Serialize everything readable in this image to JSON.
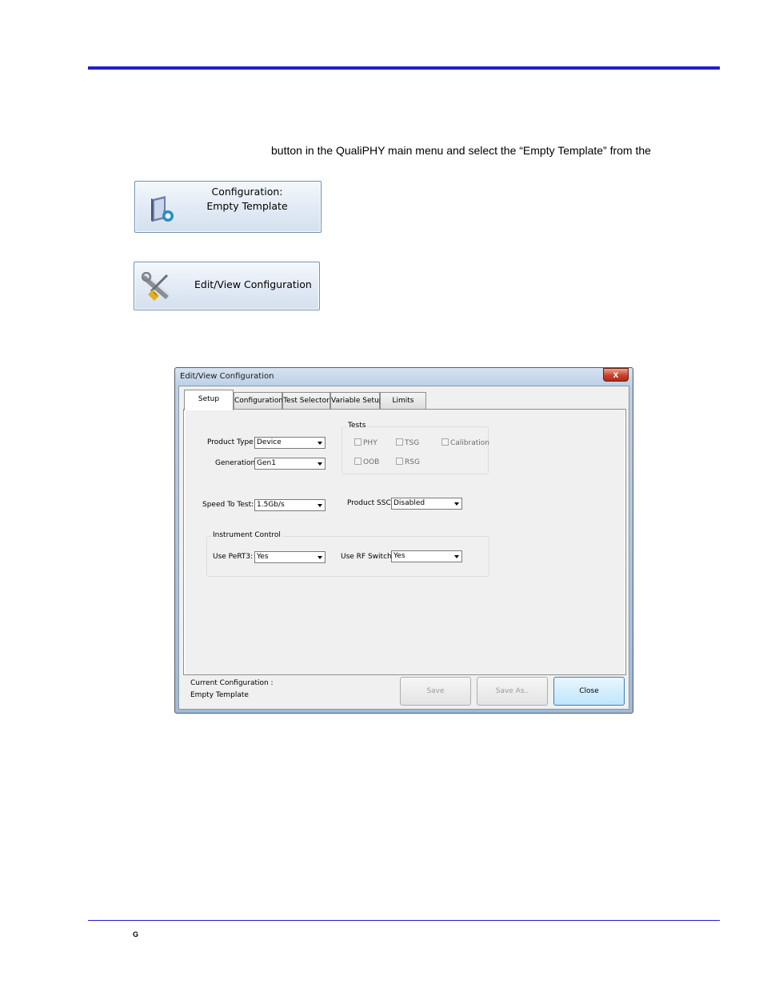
{
  "document": {
    "instruction_text": "button in the QualiPHY main menu and select the “Empty Template” from the",
    "footer_mark": "G"
  },
  "buttons": {
    "configuration": {
      "line1": "Configuration:",
      "line2": "Empty Template",
      "icon": "configuration-icon"
    },
    "edit_view": {
      "label": "Edit/View Configuration",
      "icon": "wrench-screwdriver-icon"
    }
  },
  "dialog": {
    "title": "Edit/View Configuration",
    "close_glyph": "x",
    "tabs": [
      {
        "label": "Setup",
        "active": true
      },
      {
        "label": "Configuration",
        "active": false
      },
      {
        "label": "Test Selector",
        "active": false
      },
      {
        "label": "Variable Setup",
        "active": false
      },
      {
        "label": "Limits",
        "active": false
      }
    ],
    "setup": {
      "product_type": {
        "label": "Product Type:",
        "value": "Device"
      },
      "generation": {
        "label": "Generation:",
        "value": "Gen1"
      },
      "speed_to_test": {
        "label": "Speed To Test:",
        "value": "1.5Gb/s"
      },
      "product_ssc": {
        "label": "Product SSC:",
        "value": "Disabled"
      },
      "tests": {
        "legend": "Tests",
        "items": [
          {
            "label": "PHY",
            "checked": false
          },
          {
            "label": "TSG",
            "checked": false
          },
          {
            "label": "Calibration",
            "checked": false
          },
          {
            "label": "OOB",
            "checked": false
          },
          {
            "label": "RSG",
            "checked": false
          }
        ]
      },
      "instrument_control": {
        "legend": "Instrument Control",
        "use_pert3": {
          "label": "Use PeRT3:",
          "value": "Yes"
        },
        "use_rf_switch": {
          "label": "Use RF Switch:",
          "value": "Yes"
        }
      }
    },
    "status": {
      "line1": "Current Configuration :",
      "line2": "Empty Template"
    },
    "footer_buttons": {
      "save": "Save",
      "save_as": "Save As..",
      "close": "Close"
    }
  }
}
